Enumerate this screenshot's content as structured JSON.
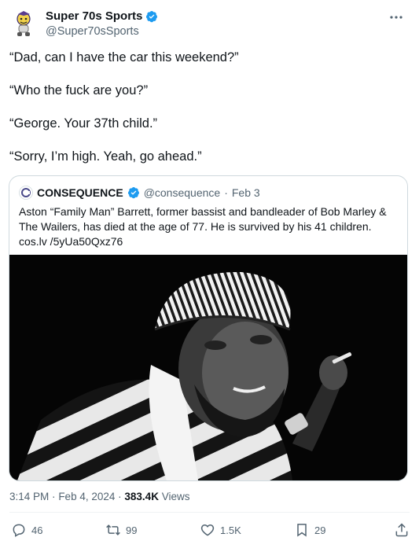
{
  "author": {
    "name": "Super 70s Sports",
    "handle": "@Super70sSports"
  },
  "tweet": {
    "lines": [
      "“Dad, can I have the car this weekend?”",
      "“Who the fuck are you?”",
      "“George. Your 37th child.”",
      "“Sorry, I’m high. Yeah, go ahead.”"
    ]
  },
  "quote": {
    "name": "CONSEQUENCE",
    "handle": "@consequence",
    "sep": "·",
    "date": "Feb 3",
    "text": "Aston “Family Man” Barrett, former bassist and bandleader of Bob Marley  & The Wailers, has died at the age of 77. He is survived by his 41 children. cos.lv /5yUa50Qxz76"
  },
  "meta": {
    "time": "3:14 PM",
    "date": "Feb 4, 2024",
    "views_count": "383.4K",
    "views_label": "Views",
    "sep": "·"
  },
  "actions": {
    "replies": "46",
    "reposts": "99",
    "likes": "1.5K",
    "bookmarks": "29"
  },
  "icons": [
    "verified-badge-icon",
    "more-icon",
    "reply-icon",
    "repost-icon",
    "like-icon",
    "bookmark-icon",
    "share-icon"
  ],
  "colors": {
    "verified": "#1d9bf0",
    "secondary_text": "#536471",
    "border": "#cfd9de"
  }
}
